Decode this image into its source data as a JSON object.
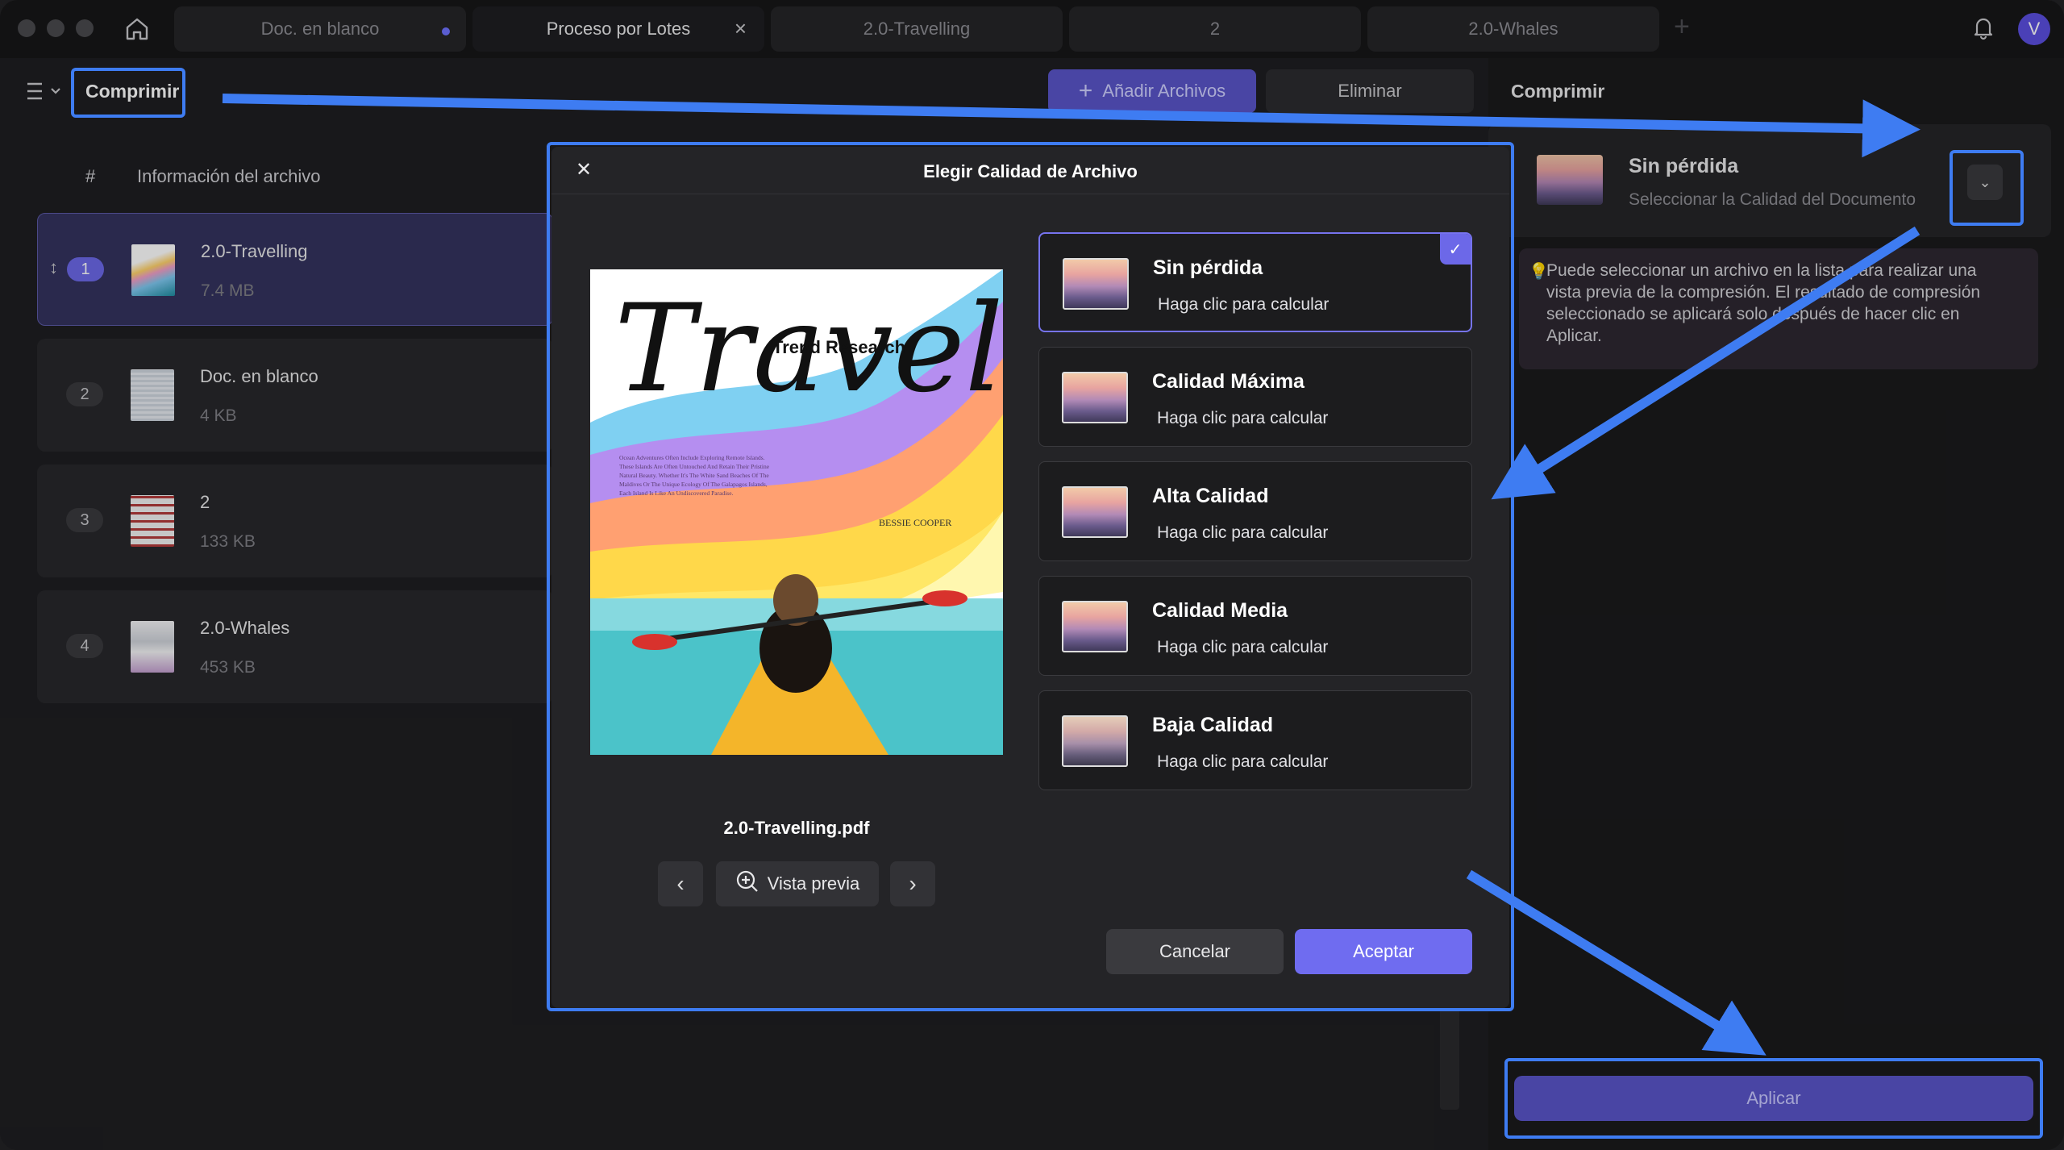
{
  "tabs": [
    {
      "label": "Doc. en blanco",
      "unsaved": true
    },
    {
      "label": "Proceso por Lotes",
      "active": true
    },
    {
      "label": "2.0-Travelling"
    },
    {
      "label": "2"
    },
    {
      "label": "2.0-Whales"
    }
  ],
  "user": {
    "initial": "V"
  },
  "toolbar": {
    "mode_label": "Comprimir",
    "add_files": "Añadir Archivos",
    "remove": "Eliminar"
  },
  "list": {
    "col_num": "#",
    "col_info": "Información del archivo",
    "files": [
      {
        "index": "1",
        "name": "2.0-Travelling",
        "size": "7.4 MB",
        "selected": true
      },
      {
        "index": "2",
        "name": "Doc. en blanco",
        "size": "4 KB"
      },
      {
        "index": "3",
        "name": "2",
        "size": "133 KB"
      },
      {
        "index": "4",
        "name": "2.0-Whales",
        "size": "453 KB"
      }
    ]
  },
  "right_panel": {
    "title": "Comprimir",
    "quality_title": "Sin pérdida",
    "quality_subtitle": "Seleccionar la Calidad del Documento",
    "tip": "Puede seleccionar un archivo en la lista para realizar una vista previa de la compresión. El resultado de compresión seleccionado se aplicará solo después de hacer clic en Aplicar.",
    "apply": "Aplicar"
  },
  "modal": {
    "title": "Elegir Calidad de Archivo",
    "filename": "2.0-Travelling.pdf",
    "preview_label": "Vista previa",
    "cover": {
      "title": "Travel",
      "subtitle": "Trend Research",
      "author": "BESSIE COOPER",
      "body": "Ocean Adventures Often Include Exploring Remote Islands. These Islands Are Often Untouched And Retain Their Pristine Natural Beauty. Whether It's The White Sand Beaches Of The Maldives Or The Unique Ecology Of The Galapagos Islands, Each Island Is Like An Undiscovered Paradise."
    },
    "options": [
      {
        "title": "Sin pérdida",
        "subtitle": "Haga clic para calcular",
        "selected": true
      },
      {
        "title": "Calidad Máxima",
        "subtitle": "Haga clic para calcular"
      },
      {
        "title": "Alta Calidad",
        "subtitle": "Haga clic para calcular"
      },
      {
        "title": "Calidad Media",
        "subtitle": "Haga clic para calcular"
      },
      {
        "title": "Baja Calidad",
        "subtitle": "Haga clic para calcular"
      }
    ],
    "cancel": "Cancelar",
    "accept": "Aceptar"
  },
  "colors": {
    "accent": "#6f6cf0",
    "annotation": "#3e7cf2",
    "background": "#1e1e21"
  }
}
